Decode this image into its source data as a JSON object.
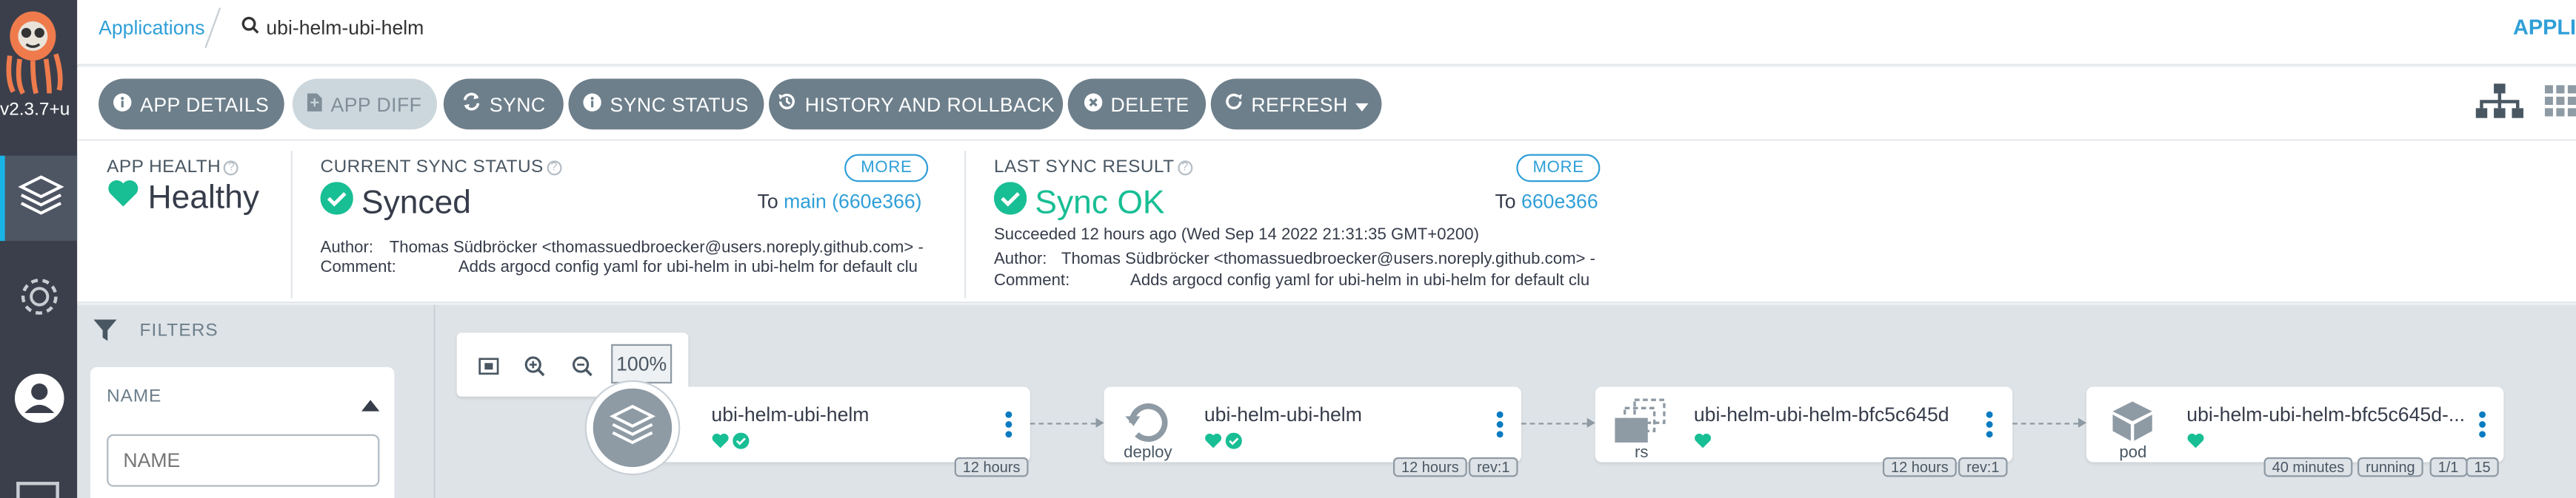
{
  "sidebar": {
    "version": "v2.3.7+u",
    "nav_icons": [
      "layers-icon",
      "gear-icon",
      "user-icon"
    ]
  },
  "topbar": {
    "breadcrumb_link": "Applications",
    "search_label": "ubi-helm-ubi-helm",
    "right_label": "APPLI"
  },
  "toolbar": {
    "buttons": [
      {
        "label": "APP DETAILS",
        "icon": "info-icon"
      },
      {
        "label": "APP DIFF",
        "icon": "file-diff-icon",
        "disabled": true
      },
      {
        "label": "SYNC",
        "icon": "sync-icon"
      },
      {
        "label": "SYNC STATUS",
        "icon": "info-icon"
      },
      {
        "label": "HISTORY AND ROLLBACK",
        "icon": "history-icon"
      },
      {
        "label": "DELETE",
        "icon": "times-circle-icon"
      },
      {
        "label": "REFRESH",
        "icon": "redo-icon"
      }
    ]
  },
  "status": {
    "app_health": {
      "label": "APP HEALTH",
      "value": "Healthy"
    },
    "current_sync": {
      "label": "CURRENT SYNC STATUS",
      "value": "Synced",
      "more": "MORE",
      "to_prefix": "To",
      "to_rev": "main (660e366)",
      "author_label": "Author:",
      "author": "Thomas Südbröcker <thomassuedbroecker@users.noreply.github.com> -",
      "comment_label": "Comment:",
      "comment": "Adds argocd config yaml for ubi-helm in ubi-helm for default clu"
    },
    "last_sync": {
      "label": "LAST SYNC RESULT",
      "value": "Sync OK",
      "more": "MORE",
      "to_prefix": "To",
      "to_rev": "660e366",
      "succeeded": "Succeeded 12 hours ago (Wed Sep 14 2022 21:31:35 GMT+0200)",
      "author_label": "Author:",
      "author": "Thomas Südbröcker <thomassuedbroecker@users.noreply.github.com> -",
      "comment_label": "Comment:",
      "comment": "Adds argocd config yaml for ubi-helm in ubi-helm for default clu"
    }
  },
  "filters": {
    "title": "FILTERS",
    "name_label": "NAME",
    "name_placeholder": "NAME"
  },
  "graph": {
    "zoom": "100%",
    "nodes": [
      {
        "title": "ubi-helm-ubi-helm",
        "kind": "",
        "badges": [
          "12 hours"
        ]
      },
      {
        "title": "ubi-helm-ubi-helm",
        "kind": "deploy",
        "badges": [
          "12 hours",
          "rev:1"
        ]
      },
      {
        "title": "ubi-helm-ubi-helm-bfc5c645d",
        "kind": "rs",
        "badges": [
          "12 hours",
          "rev:1"
        ]
      },
      {
        "title": "ubi-helm-ubi-helm-bfc5c645d-...",
        "kind": "pod",
        "badges": [
          "40 minutes",
          "running",
          "1/1",
          "15"
        ]
      }
    ]
  },
  "colors": {
    "healthy": "#18be94",
    "link": "#2f9fd7",
    "button": "#6d7f8b",
    "sidebar": "#3a3f4b"
  }
}
